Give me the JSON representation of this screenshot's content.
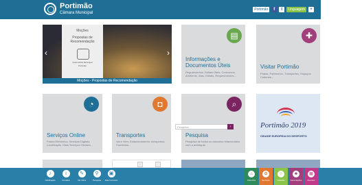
{
  "header": {
    "logo_title": "Portimão",
    "logo_subtitle": "Câmara Municipal",
    "links": [
      "Portimão",
      "f",
      "t",
      "Linguagem",
      "+"
    ]
  },
  "slider": {
    "panel_title": "Moções",
    "panel_subtitle": "Propostas de Recomendação",
    "crest_caption": "Assembleia Municipal",
    "crest_name": "Portimão",
    "caption": "Moções - Propostas de Recomendação",
    "prev_icon": "chevron-left",
    "next_icon": "chevron-right"
  },
  "tiles": {
    "informacoes": {
      "title": "Informações e Documentos Úteis",
      "desc": "Regulamentos, Editais Úteis, Concursos, Ambiente, Atas, Editais, Requerimentos...",
      "icon": "document-icon",
      "color": "#6aa84f"
    },
    "visitar": {
      "title": "Visitar Portimão",
      "desc": "Praias, Património, Transportes, Espaços Culturais...",
      "icon": "plus-icon",
      "color": "#a23e7c"
    },
    "servicos": {
      "title": "Serviços Online",
      "desc": "Fatura Eletrónica, Serviços Digitais, Localização, Mais Serviços Câmara...",
      "icon": "mouse-icon",
      "color": "#1f6e96"
    },
    "transportes": {
      "title": "Transportes",
      "desc": "Vai e Vem, Estacionamento, Aeroportos, Comboios...",
      "icon": "car-icon",
      "color": "#e0792f"
    },
    "pesquisa": {
      "title": "Pesquisa",
      "desc": "Pesquisa de todos os assuntos relacionados com a autarquia",
      "icon": "search-icon",
      "color": "#7a2561",
      "field_placeholder": "Pesquisa...",
      "button_icon": "arrow-right"
    },
    "portimao2019": {
      "brand": "Portimão 2019",
      "subtitle": "CIDADE EUROPEIA DO DESPORTO"
    }
  },
  "footer": {
    "left_items": [
      {
        "label": "Notificação",
        "icon": "bell-icon"
      },
      {
        "label": "Contatar",
        "icon": "info-icon"
      },
      {
        "label": "Ver Obra",
        "icon": "pencil-icon"
      },
      {
        "label": "Pesquisa",
        "icon": "map-pin-icon"
      },
      {
        "label": "Fale Conosco",
        "icon": "chat-icon"
      }
    ],
    "right_items": [
      {
        "label": "Anúncios",
        "icon": "home-icon",
        "color": "#2f8a5b"
      },
      {
        "label": "Serviços",
        "icon": "gear-icon",
        "color": "#e0792f"
      },
      {
        "label": "Cidadão",
        "icon": "person-icon",
        "color": "#8ac54a"
      },
      {
        "label": "Associações",
        "icon": "group-icon",
        "color": "#a23e7c"
      },
      {
        "label": "Eventos",
        "icon": "calendar-icon",
        "color": "#c13a8a"
      }
    ]
  }
}
